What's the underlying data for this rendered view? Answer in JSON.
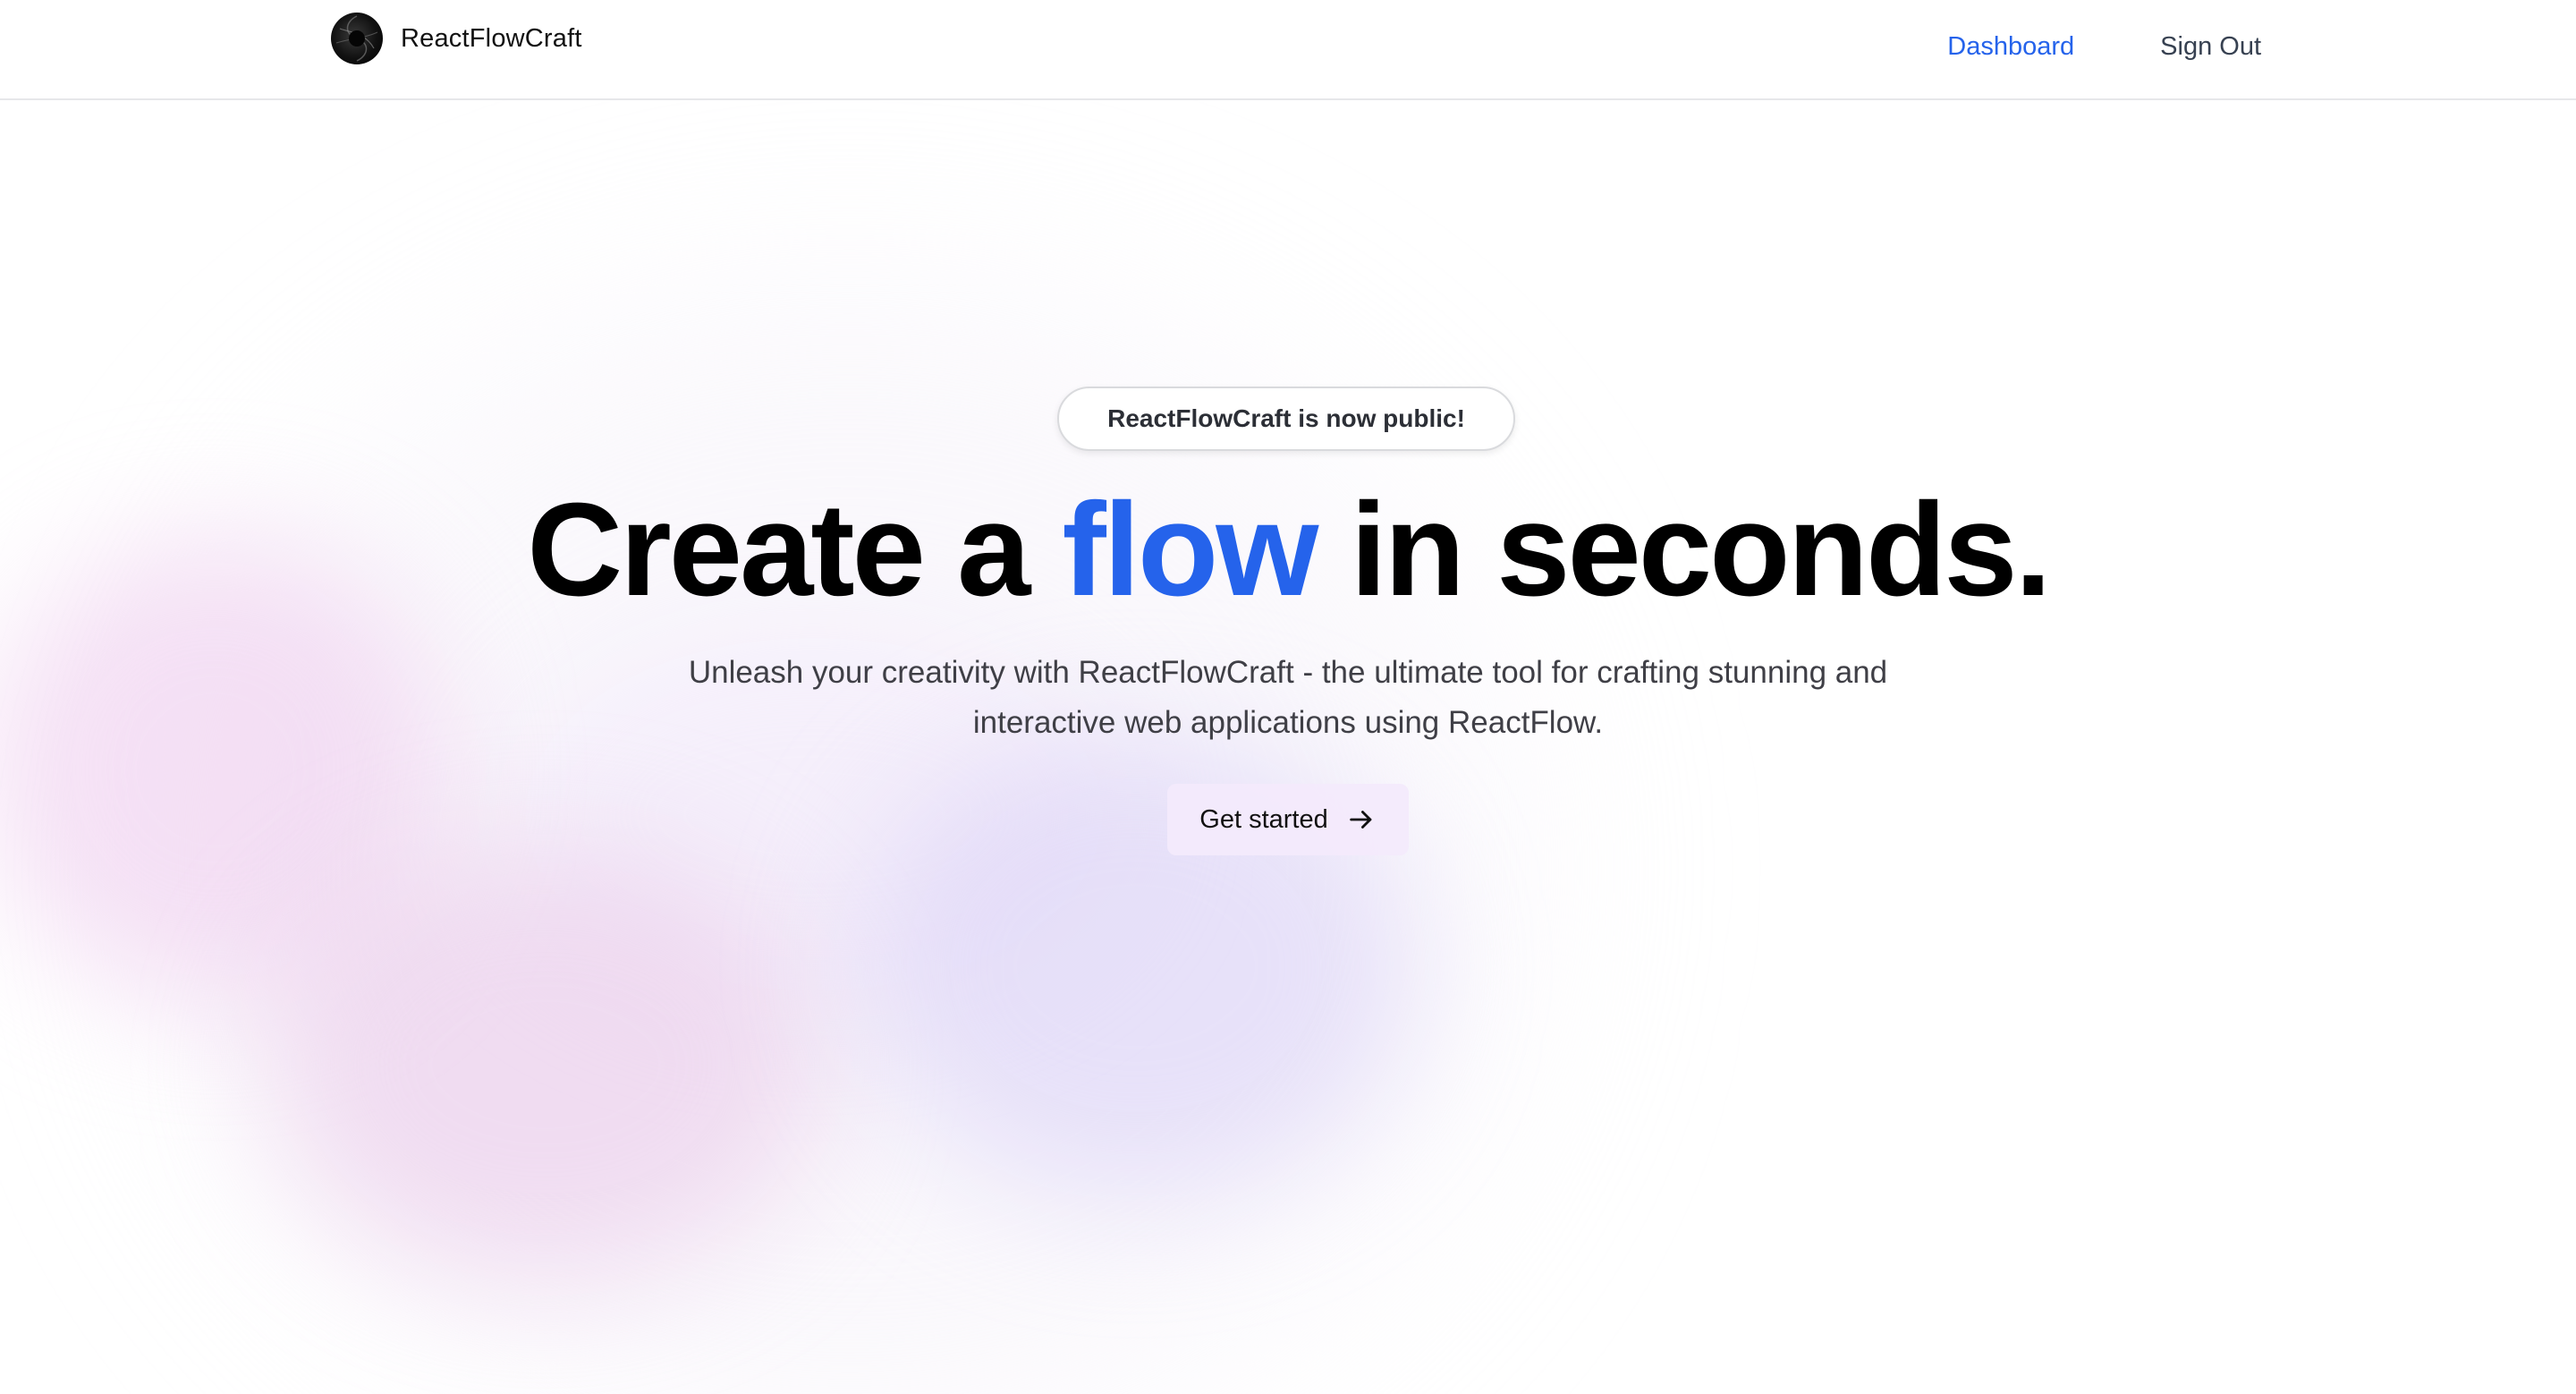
{
  "header": {
    "brand": "ReactFlowCraft",
    "nav": {
      "dashboard": "Dashboard",
      "sign_out": "Sign Out"
    }
  },
  "hero": {
    "badge": "ReactFlowCraft is now public!",
    "headline_before": "Create a ",
    "headline_accent": "flow",
    "headline_after": " in seconds.",
    "subtitle_line1": "Unleash your creativity with ReactFlowCraft - the ultimate tool for crafting stunning and",
    "subtitle_line2": "interactive web applications using ReactFlow.",
    "cta_label": "Get started",
    "cta_icon": "arrow-right-icon"
  },
  "colors": {
    "accent": "#2563eb",
    "text": "#000000",
    "muted": "#3f3f46",
    "border": "#e6e7ea",
    "cta_bg": "#f3eafc"
  }
}
